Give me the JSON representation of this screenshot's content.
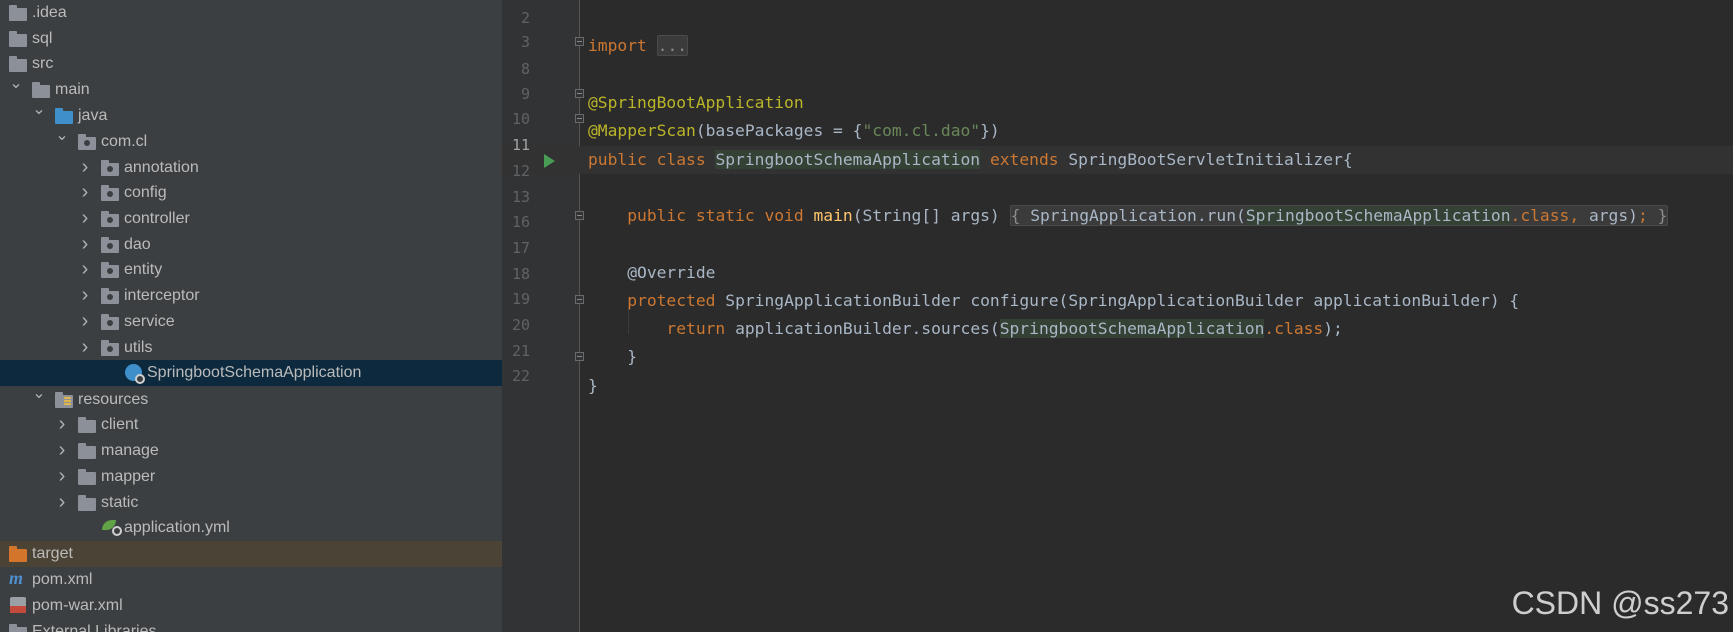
{
  "project_tree": {
    "items": [
      {
        "label": ".idea",
        "icon": "folder-icon",
        "expanded": null
      },
      {
        "label": "sql",
        "icon": "folder-icon",
        "expanded": null
      },
      {
        "label": "src",
        "icon": "folder-icon",
        "expanded": null
      },
      {
        "label": "main",
        "icon": "folder-icon",
        "expanded": true
      },
      {
        "label": "java",
        "icon": "source-folder-icon",
        "expanded": true
      },
      {
        "label": "com.cl",
        "icon": "package-icon",
        "expanded": true
      },
      {
        "label": "annotation",
        "icon": "package-icon",
        "expanded": false
      },
      {
        "label": "config",
        "icon": "package-icon",
        "expanded": false
      },
      {
        "label": "controller",
        "icon": "package-icon",
        "expanded": false
      },
      {
        "label": "dao",
        "icon": "package-icon",
        "expanded": false
      },
      {
        "label": "entity",
        "icon": "package-icon",
        "expanded": false
      },
      {
        "label": "interceptor",
        "icon": "package-icon",
        "expanded": false
      },
      {
        "label": "service",
        "icon": "package-icon",
        "expanded": false
      },
      {
        "label": "utils",
        "icon": "package-icon",
        "expanded": false
      },
      {
        "label": "SpringbootSchemaApplication",
        "icon": "spring-boot-class-icon",
        "expanded": null,
        "selected": true
      },
      {
        "label": "resources",
        "icon": "resources-folder-icon",
        "expanded": true
      },
      {
        "label": "client",
        "icon": "folder-icon",
        "expanded": false
      },
      {
        "label": "manage",
        "icon": "folder-icon",
        "expanded": false
      },
      {
        "label": "mapper",
        "icon": "folder-icon",
        "expanded": false
      },
      {
        "label": "static",
        "icon": "folder-icon",
        "expanded": false
      },
      {
        "label": "application.yml",
        "icon": "spring-config-file-icon",
        "expanded": null
      },
      {
        "label": "target",
        "icon": "excluded-folder-icon",
        "expanded": null
      },
      {
        "label": "pom.xml",
        "icon": "maven-icon",
        "expanded": null
      },
      {
        "label": "pom-war.xml",
        "icon": "xml-file-icon",
        "expanded": null
      },
      {
        "label": "External Libraries",
        "icon": "library-icon",
        "expanded": null
      }
    ]
  },
  "editor": {
    "line_numbers": [
      "2",
      "3",
      "8",
      "9",
      "10",
      "11",
      "12",
      "13",
      "16",
      "17",
      "18",
      "19",
      "20",
      "21",
      "22"
    ],
    "current_line": "11",
    "code": {
      "import_kw": "import",
      "import_fold": "...",
      "ann_springboot": "@SpringBootApplication",
      "ann_mapperscan": "@MapperScan",
      "mapperscan_open": "(basePackages = {",
      "mapperscan_str": "\"com.cl.dao\"",
      "mapperscan_close": "})",
      "public_class": "public class",
      "class_name": "SpringbootSchemaApplication",
      "extends_kw": "extends",
      "superclass": "SpringBootServletInitializer{",
      "main_mods": "public static void",
      "main_name": "main",
      "main_params": "(String[] args)",
      "main_body_open": "{",
      "main_body_call": "SpringApplication.run(",
      "main_body_class": "SpringbootSchemaApplication",
      "main_body_dotclass": ".class,",
      "main_body_args": "args)",
      "main_body_semi": ";",
      "main_body_close": "}",
      "override": "@Override",
      "protected_kw": "protected",
      "configure_sig": "SpringApplicationBuilder configure(SpringApplicationBuilder applicationBuilder) {",
      "return_kw": "return",
      "return_call": "applicationBuilder.sources(",
      "return_class": "SpringbootSchemaApplication",
      "return_dotclass": ".class",
      "return_end": ");",
      "close_method": "}",
      "close_class": "}"
    }
  },
  "watermark": "CSDN @ss273",
  "colors": {
    "keyword": "#cc7832",
    "annotation": "#bbb529",
    "string": "#6a8759",
    "function": "#ffc66d",
    "text": "#a9b7c6"
  }
}
